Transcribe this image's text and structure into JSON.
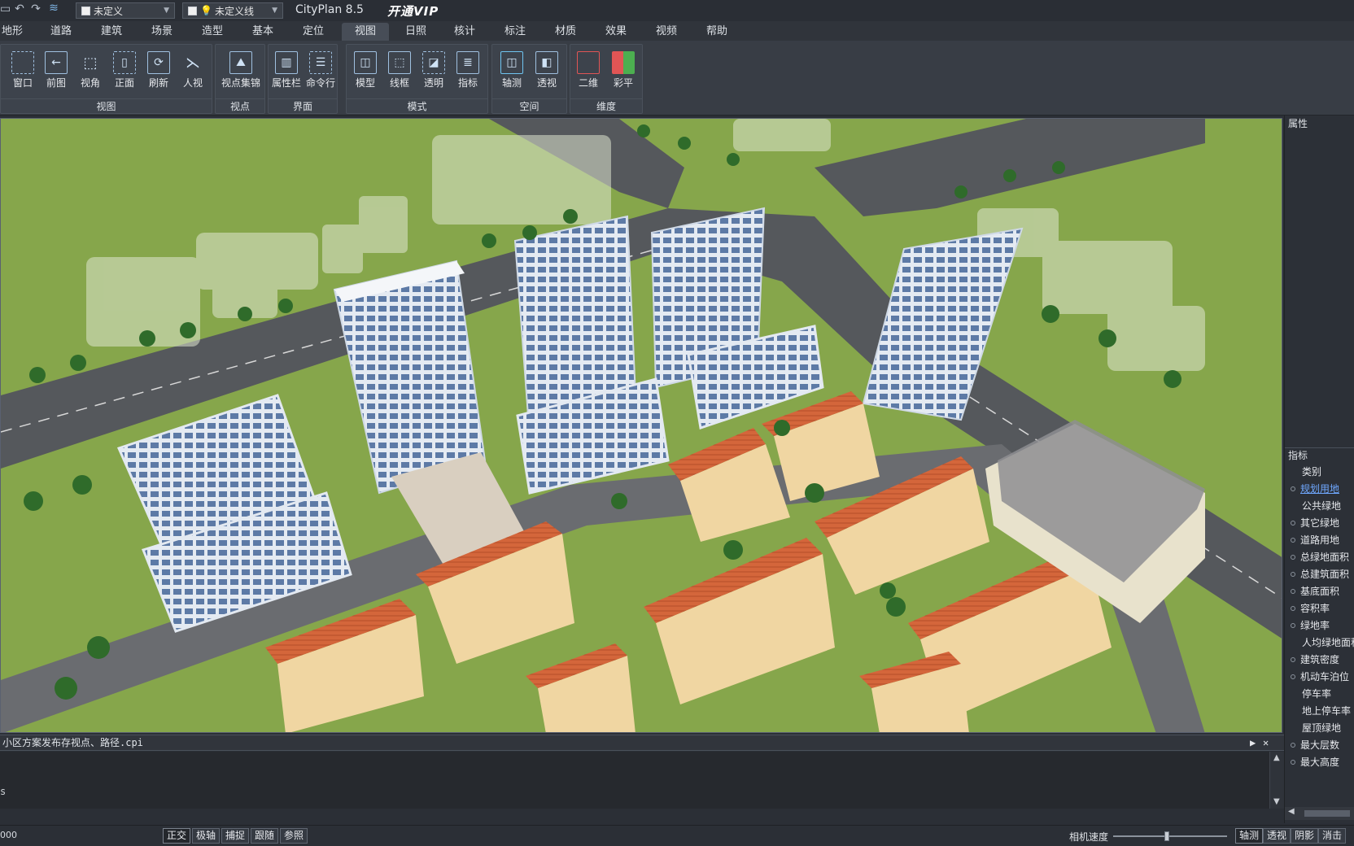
{
  "titlebar": {
    "layer_value": "未定义",
    "linetype_value": "未定义线",
    "app_title": "CityPlan 8.5",
    "vip_label": "开通VIP"
  },
  "menu": {
    "tabs": [
      "地形",
      "道路",
      "建筑",
      "场景",
      "造型",
      "基本",
      "定位",
      "视图",
      "日照",
      "核计",
      "标注",
      "材质",
      "效果",
      "视频",
      "帮助"
    ],
    "active_tab": "视图"
  },
  "ribbon": {
    "groups": [
      {
        "label": "视图",
        "buttons": [
          "窗口",
          "前图",
          "视角",
          "正面",
          "刷新",
          "人视"
        ]
      },
      {
        "label": "视点",
        "buttons": [
          "视点集锦"
        ]
      },
      {
        "label": "界面",
        "buttons": [
          "属性栏",
          "命令行"
        ]
      },
      {
        "label": "模式",
        "buttons": [
          "模型",
          "线框",
          "透明",
          "指标"
        ]
      },
      {
        "label": "空间",
        "buttons": [
          "轴测",
          "透视"
        ]
      },
      {
        "label": "维度",
        "buttons": [
          "二维",
          "彩平"
        ]
      }
    ]
  },
  "right_panel": {
    "properties_title": "属性",
    "metrics_title": "指标",
    "metrics": [
      {
        "label": "类别",
        "dot": false
      },
      {
        "label": "规划用地",
        "dot": true,
        "active": true
      },
      {
        "label": "公共绿地",
        "dot": false
      },
      {
        "label": "其它绿地",
        "dot": true
      },
      {
        "label": "道路用地",
        "dot": true
      },
      {
        "label": "总绿地面积",
        "dot": true
      },
      {
        "label": "总建筑面积",
        "dot": true
      },
      {
        "label": "基底面积",
        "dot": true
      },
      {
        "label": "容积率",
        "dot": true
      },
      {
        "label": "绿地率",
        "dot": true
      },
      {
        "label": "人均绿地面积",
        "dot": false
      },
      {
        "label": "建筑密度",
        "dot": true
      },
      {
        "label": "机动车泊位",
        "dot": true
      },
      {
        "label": "停车率",
        "dot": false
      },
      {
        "label": "地上停车率",
        "dot": false
      },
      {
        "label": "屋顶绿地",
        "dot": false
      },
      {
        "label": "最大层数",
        "dot": true
      },
      {
        "label": "最大高度",
        "dot": true
      }
    ]
  },
  "command": {
    "title": "小区方案发布存视点、路径.cpi",
    "text": "s"
  },
  "statusbar": {
    "coord": "000",
    "modes": [
      "正交",
      "极轴",
      "捕捉",
      "跟随",
      "参照"
    ],
    "camera_speed_label": "相机速度",
    "camera_speed_level": 0.47,
    "view_buttons": [
      "轴测",
      "透视",
      "阴影",
      "消击"
    ]
  },
  "colors": {
    "grass": "#7f9e46",
    "road": "#55585c",
    "roof_tile": "#d4663b",
    "villa_wall": "#f0d6a2",
    "tower_glass": "#7f99bf",
    "active_link": "#6fa8ff"
  }
}
